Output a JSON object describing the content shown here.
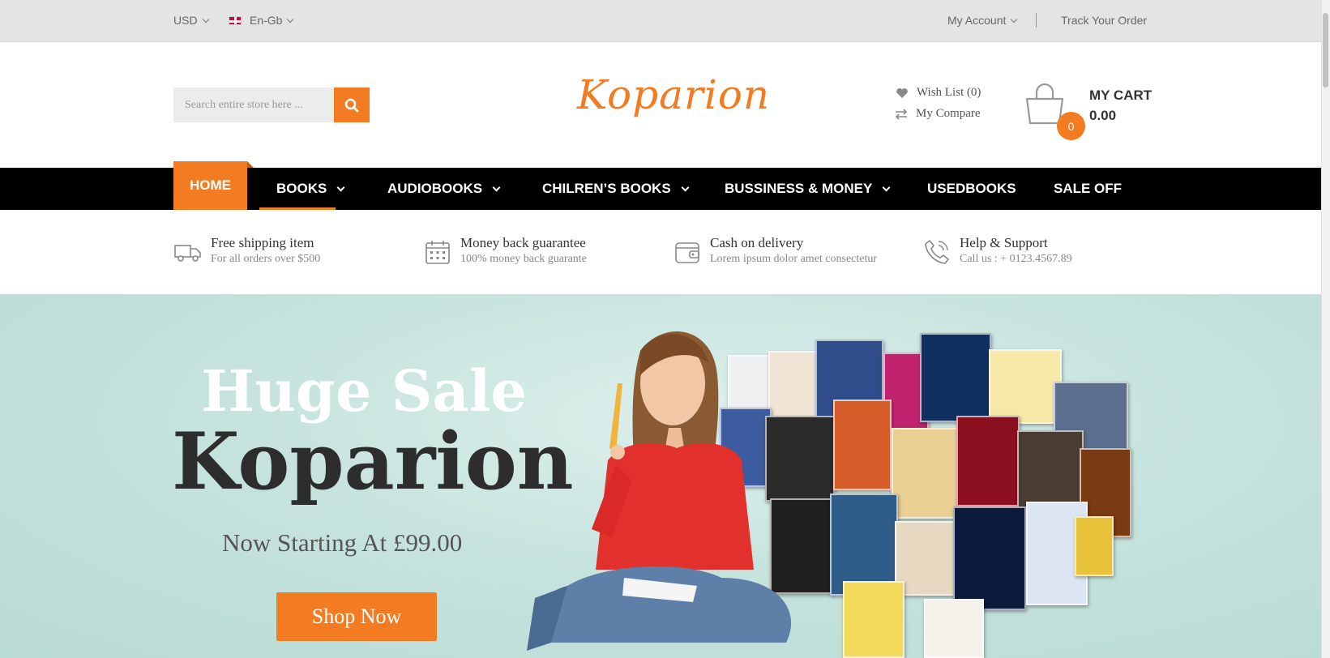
{
  "topbar": {
    "currency": "USD",
    "language": "En-Gb",
    "my_account": "My Account",
    "track_order": "Track Your Order"
  },
  "header": {
    "search_placeholder": "Search entire store here ...",
    "logo": "Koparion",
    "wishlist": "Wish List (0)",
    "compare": "My Compare",
    "cart_count": "0",
    "cart_title": "MY CART",
    "cart_total": "0.00"
  },
  "nav": {
    "items": [
      {
        "label": "HOME"
      },
      {
        "label": "BOOKS"
      },
      {
        "label": "AUDIOBOOKS"
      },
      {
        "label": "CHILREN’S BOOKS"
      },
      {
        "label": "BUSSINESS & MONEY"
      },
      {
        "label": "USEDBOOKS"
      },
      {
        "label": "SALE OFF"
      }
    ]
  },
  "features": [
    {
      "icon": "truck-icon",
      "title": "Free shipping item",
      "subtitle": "For all orders over $500"
    },
    {
      "icon": "calendar-icon",
      "title": "Money back guarantee",
      "subtitle": "100% money back guarante"
    },
    {
      "icon": "wallet-icon",
      "title": "Cash on delivery",
      "subtitle": "Lorem ipsum dolor amet consectetur"
    },
    {
      "icon": "phone-icon",
      "title": "Help & Support",
      "subtitle": "Call us : + 0123.4567.89"
    }
  ],
  "hero": {
    "line1": "Huge Sale",
    "line2": "Koparion",
    "line3": "Now Starting At £99.00",
    "button": "Shop Now"
  },
  "colors": {
    "accent": "#f37b21",
    "nav_bg": "#000000",
    "hero_bg": "#c7e3dd"
  }
}
